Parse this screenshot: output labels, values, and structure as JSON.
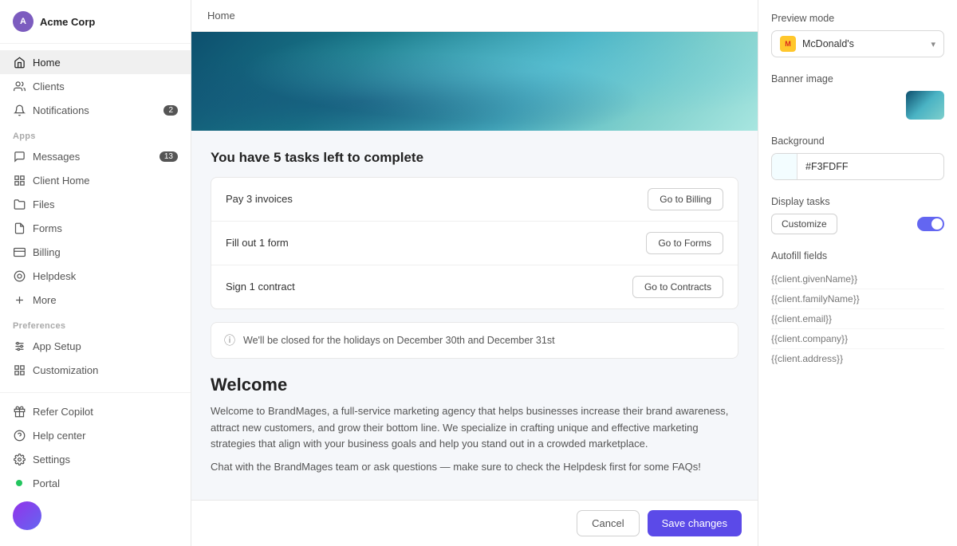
{
  "sidebar": {
    "brand": "Acme Corp",
    "nav_main": [
      {
        "id": "home",
        "label": "Home",
        "icon": "home",
        "active": true
      },
      {
        "id": "clients",
        "label": "Clients",
        "icon": "users"
      },
      {
        "id": "notifications",
        "label": "Notifications",
        "icon": "bell",
        "badge": "2"
      }
    ],
    "section_apps": "Apps",
    "nav_apps": [
      {
        "id": "messages",
        "label": "Messages",
        "icon": "message",
        "badge": "13"
      },
      {
        "id": "client-home",
        "label": "Client Home",
        "icon": "grid",
        "active_item": true
      },
      {
        "id": "files",
        "label": "Files",
        "icon": "folder"
      },
      {
        "id": "forms",
        "label": "Forms",
        "icon": "file-text"
      },
      {
        "id": "billing",
        "label": "Billing",
        "icon": "credit-card"
      },
      {
        "id": "helpdesk",
        "label": "Helpdesk",
        "icon": "life-buoy"
      },
      {
        "id": "more",
        "label": "More",
        "icon": "plus"
      }
    ],
    "section_prefs": "Preferences",
    "nav_prefs": [
      {
        "id": "app-setup",
        "label": "App Setup",
        "icon": "sliders"
      },
      {
        "id": "customization",
        "label": "Customization",
        "icon": "grid"
      }
    ],
    "nav_bottom": [
      {
        "id": "refer",
        "label": "Refer Copilot",
        "icon": "gift"
      },
      {
        "id": "help",
        "label": "Help center",
        "icon": "help-circle"
      },
      {
        "id": "settings",
        "label": "Settings",
        "icon": "settings"
      }
    ],
    "portal": "Portal"
  },
  "topbar": {
    "breadcrumb": "Home"
  },
  "main": {
    "tasks_title": "You have 5 tasks left to complete",
    "tasks": [
      {
        "label": "Pay 3 invoices",
        "btn": "Go to Billing"
      },
      {
        "label": "Fill out 1 form",
        "btn": "Go to Forms"
      },
      {
        "label": "Sign 1 contract",
        "btn": "Go to Contracts"
      }
    ],
    "notice": "We'll be closed for the holidays on December 30th and December 31st",
    "welcome_title": "Welcome",
    "welcome_p1": "Welcome to BrandMages, a full-service marketing agency that helps businesses increase their brand awareness, attract new customers, and grow their bottom line. We specialize in crafting unique and effective marketing strategies that align with your business goals and help you stand out in a crowded marketplace.",
    "welcome_p2": "Chat with the BrandMages team or ask questions — make sure to check the Helpdesk first for some FAQs!"
  },
  "panel": {
    "preview_label": "Preview mode",
    "preview_value": "McDonald's",
    "banner_label": "Banner image",
    "background_label": "Background",
    "background_value": "#F3FDFF",
    "display_tasks_label": "Display tasks",
    "customize_btn": "Customize",
    "autofill_label": "Autofill fields",
    "autofill_fields": [
      "{{client.givenName}}",
      "{{client.familyName}}",
      "{{client.email}}",
      "{{client.company}}",
      "{{client.address}}"
    ]
  },
  "footer": {
    "cancel": "Cancel",
    "save": "Save changes"
  }
}
